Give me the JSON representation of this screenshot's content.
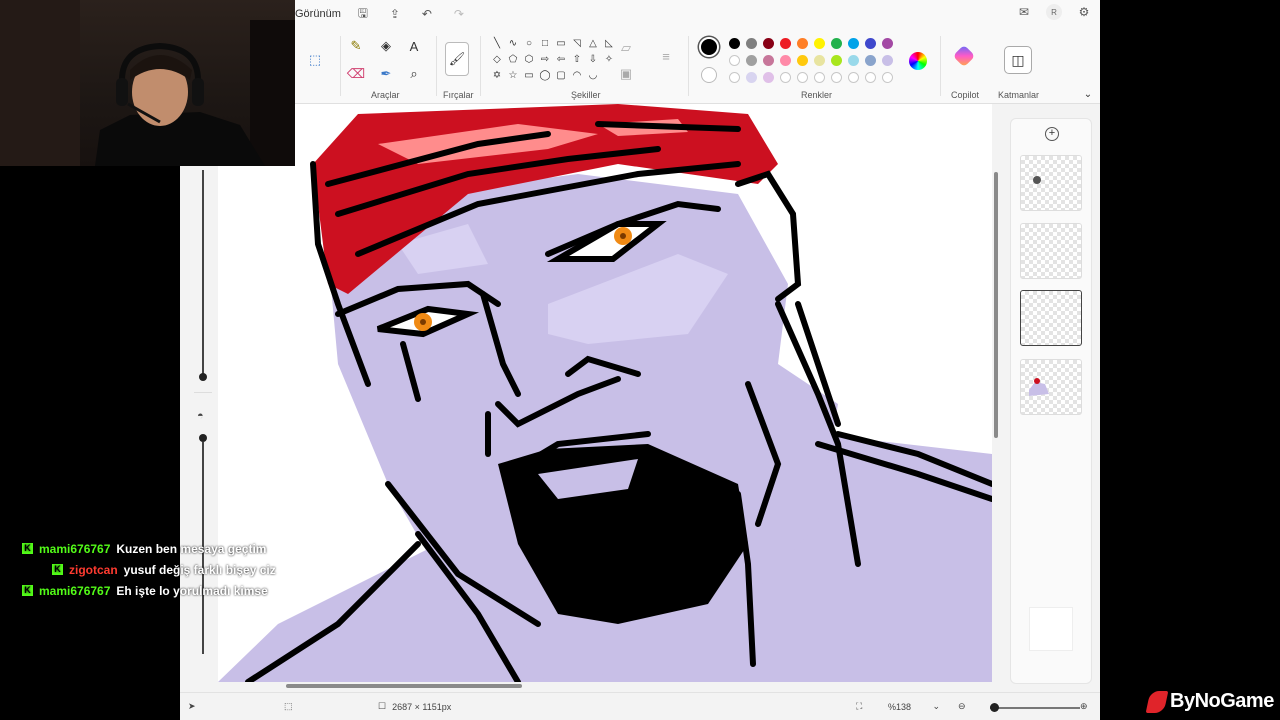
{
  "menu": {
    "view_label": "Görünüm"
  },
  "ribbon": {
    "groups": {
      "tools": "Araçlar",
      "brushes": "Fırçalar",
      "shapes": "Şekiller",
      "colors": "Renkler",
      "copilot": "Copilot",
      "layers": "Katmanlar"
    },
    "tool_icons": [
      "pencil-icon",
      "fill-bucket-icon",
      "text-icon",
      "eraser-icon",
      "color-picker-icon",
      "magnifier-icon"
    ],
    "shape_glyphs": [
      "╲",
      "∿",
      "○",
      "□",
      "▭",
      "◹",
      "△",
      "◺",
      "◇",
      "⬠",
      "⬡",
      "⇨",
      "⇦",
      "⇧",
      "⇩",
      "✧",
      "✡",
      "☆",
      "▭",
      "◯",
      "▢",
      "◠",
      "◡"
    ]
  },
  "palette": {
    "primary": "#000000",
    "secondary": "#ffffff",
    "row1": [
      "#000000",
      "#7f7f7f",
      "#880015",
      "#ed1c24",
      "#ff7f27",
      "#fff200",
      "#22b14c",
      "#00a2e8",
      "#3f48cc",
      "#a349a4"
    ],
    "row2": [
      "#ffffff",
      "#c3c3c3",
      "#b97a57",
      "#ffaec9",
      "#ffc90e",
      "#efe4b0",
      "#b5e61d",
      "#99d9ea",
      "#7092be",
      "#c8bfe7"
    ],
    "row3": [
      "#ffffff",
      "#d0cee8",
      "#e8c8e8",
      "#c8bfe7",
      "#ffffff",
      "#ffffff",
      "#ffffff",
      "#ffffff",
      "#ffffff",
      "#ffffff"
    ],
    "swatch_colors_row2": [
      "#ffffff",
      "#a0a0a0",
      "#c7769a",
      "#ff8aa8",
      "#ffc90e",
      "#e8e4a0",
      "#a8e61d",
      "#99d9ea",
      "#8aa4cc",
      "#c8bfe7"
    ],
    "swatch_colors_row3": [
      "#ffffff",
      "#d8d4f0",
      "#e0c0e8",
      "#ffffff",
      "#ffffff",
      "#ffffff",
      "#ffffff",
      "#ffffff",
      "#ffffff",
      "#ffffff"
    ]
  },
  "status": {
    "canvas_size": "2687 × 1151px",
    "zoom": "%138"
  },
  "chat": [
    {
      "user": "mami676767",
      "user_color": "#53fc18",
      "message": "Kuzen ben mesaya geçtim"
    },
    {
      "user": "zigotcan",
      "user_color": "#ff3b30",
      "message": "yusuf değiş farklı bişey ciz"
    },
    {
      "user": "mami676767",
      "user_color": "#53fc18",
      "message": "Eh işte lo yorulmadı kimse"
    }
  ],
  "brand": {
    "name": "ByNoGame"
  },
  "canvas": {
    "skin": "#c8bfe7",
    "skin_light": "#d8d1f2",
    "bandana": "#cc1020",
    "bandana_light": "#ff8c8c",
    "eye": "#f08a14"
  }
}
